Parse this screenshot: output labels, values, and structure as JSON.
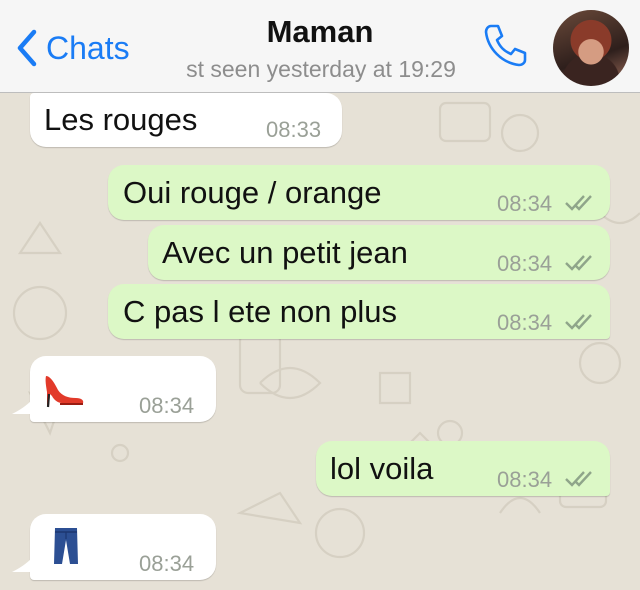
{
  "header": {
    "back_label": "Chats",
    "contact_name": "Maman",
    "last_seen": "st seen yesterday at 19:29"
  },
  "messages": [
    {
      "direction": "in",
      "text": "Les rouges",
      "time": "08:33"
    },
    {
      "direction": "out",
      "text": "Oui rouge / orange",
      "time": "08:34",
      "status": "read"
    },
    {
      "direction": "out",
      "text": "Avec un petit jean",
      "time": "08:34",
      "status": "read"
    },
    {
      "direction": "out",
      "text": "C pas l ete non plus",
      "time": "08:34",
      "status": "read"
    },
    {
      "direction": "in",
      "emoji": "high-heel-shoe",
      "time": "08:34"
    },
    {
      "direction": "out",
      "text": "lol voila",
      "time": "08:34",
      "status": "read"
    },
    {
      "direction": "in",
      "emoji": "jeans",
      "time": "08:34"
    }
  ],
  "colors": {
    "accent": "#1a7cf5",
    "incoming_bubble": "#ffffff",
    "outgoing_bubble": "#dcf8c6",
    "chat_background": "#e6e1d6",
    "tick": "#8fa58a"
  }
}
